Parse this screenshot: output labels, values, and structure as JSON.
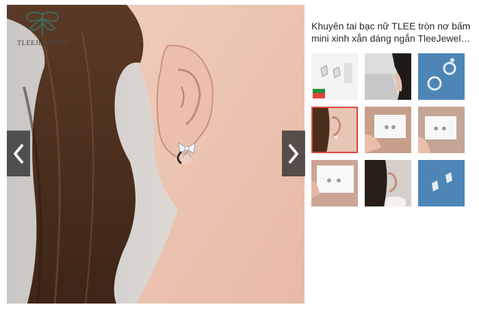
{
  "brand": {
    "logo_text": "TLEEJEWELRY"
  },
  "product": {
    "title_line1": "Khuyên tai bạc nữ TLEE tròn nơ bấm",
    "title_line2": "mini xinh xắn dáng ngắn TleeJewel…"
  },
  "gallery": {
    "prev_icon": "chevron-left-icon",
    "next_icon": "chevron-right-icon",
    "active_index": 3,
    "thumbnail_count": 9
  },
  "colors": {
    "active_border": "#e0453a",
    "nav_bg": "#2d2d2d"
  }
}
